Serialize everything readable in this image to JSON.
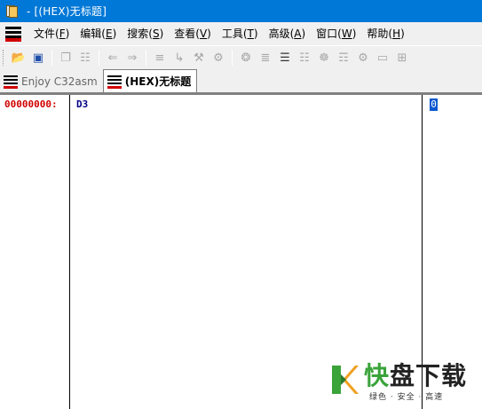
{
  "window": {
    "title": "- [(HEX)无标题]"
  },
  "menu": {
    "items": [
      {
        "text": "文件(",
        "key": "F",
        "end": ")"
      },
      {
        "text": "编辑(",
        "key": "E",
        "end": ")"
      },
      {
        "text": "搜索(",
        "key": "S",
        "end": ")"
      },
      {
        "text": "查看(",
        "key": "V",
        "end": ")"
      },
      {
        "text": "工具(",
        "key": "T",
        "end": ")"
      },
      {
        "text": "高级(",
        "key": "A",
        "end": ")"
      },
      {
        "text": "窗口(",
        "key": "W",
        "end": ")"
      },
      {
        "text": "帮助(",
        "key": "H",
        "end": ")"
      }
    ]
  },
  "toolbar": {
    "icons": [
      "open-folder",
      "save-disk",
      "copy",
      "find-file",
      "undo-arrow",
      "redo-arrow",
      "format",
      "indent",
      "tool-a",
      "tool-b",
      "settings-gear",
      "list-a",
      "list-b",
      "grid-a",
      "grid-b",
      "grid-c",
      "gear",
      "rect",
      "table"
    ]
  },
  "tabs": [
    {
      "label": "Enjoy C32asm",
      "active": false
    },
    {
      "label": "(HEX)无标题",
      "active": true
    }
  ],
  "editor": {
    "address": "00000000:",
    "hex_value": "D3",
    "ascii_value": "0"
  },
  "watermark": {
    "title_green": "快",
    "title_dark": "盘下载",
    "subtitle": "绿色 · 安全 · 高速"
  },
  "colors": {
    "titlebar": "#0078d7",
    "address": "#d10000",
    "hex": "#000080",
    "cursor": "#0a58d0",
    "brand_green": "#3aa33a"
  }
}
